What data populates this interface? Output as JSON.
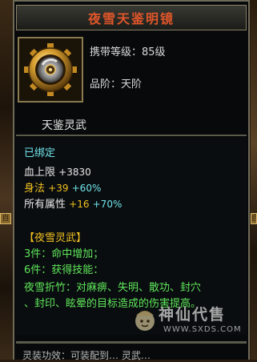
{
  "title": "夜雪天鉴明镜",
  "item_info": {
    "level_req": "携带等级：85级",
    "grade": "品阶：天阶"
  },
  "set_name_header": "天鉴灵武",
  "stats": {
    "bound": "已绑定",
    "hp_label": "血上限",
    "hp_value": "+3830",
    "agility_label": "身法",
    "agility_value": "+39",
    "agility_pct": "+60%",
    "all_label": "所有属性",
    "all_value": "+16",
    "all_pct": "+70%"
  },
  "set_bonus": {
    "name": "【夜雪灵武】",
    "piece3": "3件：命中增加；",
    "piece6": "6件：获得技能：",
    "skill_line1": "夜雪折竹：对麻痹、失明、散功、封穴",
    "skill_line2": "、封印、眩晕的目标造成的伤害提高。"
  },
  "bottom_text": "灵装功效：可装配到… 灵武…",
  "side_tabs": {
    "left": "自",
    "right": "自"
  },
  "watermark": {
    "title": "神仙代售",
    "url": "WWW.SXDS.COM"
  },
  "icon": "ornate-mirror-gear-icon",
  "colors": {
    "title": "#e0562a",
    "cyan": "#6fe4ea",
    "green": "#5ee65a",
    "gold": "#f0c020",
    "blue": "#3aa8f0"
  }
}
